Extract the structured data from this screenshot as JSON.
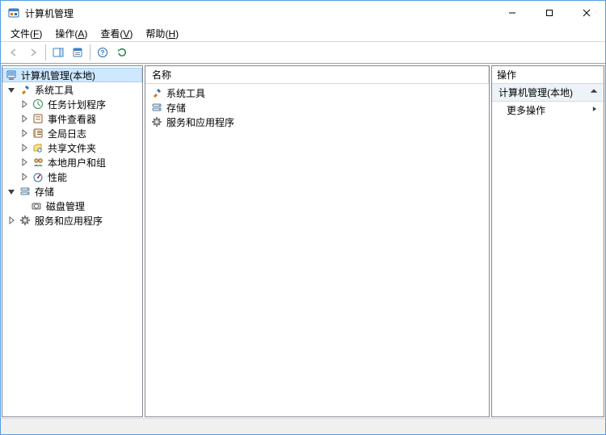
{
  "title": "计算机管理",
  "menubar": {
    "file": {
      "label": "文件",
      "mn": "F"
    },
    "action": {
      "label": "操作",
      "mn": "A"
    },
    "view": {
      "label": "查看",
      "mn": "V"
    },
    "help": {
      "label": "帮助",
      "mn": "H"
    }
  },
  "tree": {
    "root": "计算机管理(本地)",
    "system_tools": "系统工具",
    "task_scheduler": "任务计划程序",
    "event_viewer": "事件查看器",
    "shared_folders": "共享文件夹",
    "local_users": "本地用户和组",
    "performance": "性能",
    "global_log": "全局日志",
    "storage": "存储",
    "disk_mgmt": "磁盘管理",
    "services_apps": "服务和应用程序"
  },
  "list": {
    "header_name": "名称",
    "items": {
      "system_tools": "系统工具",
      "storage": "存储",
      "services_apps": "服务和应用程序"
    }
  },
  "actions": {
    "header": "操作",
    "category": "计算机管理(本地)",
    "more": "更多操作"
  }
}
